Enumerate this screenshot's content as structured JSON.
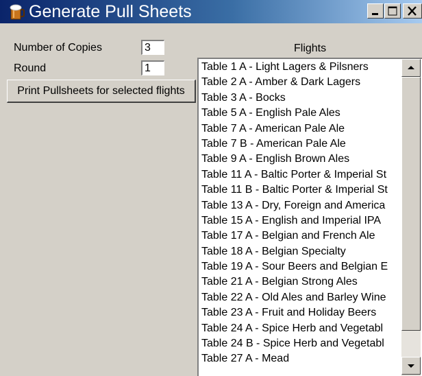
{
  "window": {
    "title": "Generate Pull Sheets",
    "minimize_label": "_",
    "icon": "beer-mug-icon"
  },
  "form": {
    "copies_label": "Number of Copies",
    "copies_value": "3",
    "round_label": "Round",
    "round_value": "1",
    "print_button_label": "Print Pullsheets for selected flights"
  },
  "flights": {
    "header": "Flights",
    "items": [
      "Table 1 A - Light Lagers & Pilsners",
      "Table 2 A - Amber & Dark Lagers",
      "Table 3 A - Bocks",
      "Table 5 A - English Pale Ales",
      "Table 7 A - American Pale Ale",
      "Table 7 B - American Pale Ale",
      "Table 9 A - English Brown Ales",
      "Table 11 A - Baltic Porter & Imperial St",
      "Table 11 B - Baltic Porter & Imperial St",
      "Table 13 A - Dry, Foreign and America",
      "Table 15 A - English and Imperial IPA",
      "Table 17 A - Belgian and French Ale",
      "Table 18 A - Belgian Specialty",
      "Table 19 A - Sour Beers and Belgian E",
      "Table 21 A - Belgian Strong Ales",
      "Table 22 A - Old Ales and Barley Wine",
      "Table 23 A - Fruit and Holiday Beers",
      "Table 24 A - Spice Herb and Vegetabl",
      "Table 24 B - Spice Herb and Vegetabl",
      "Table 27 A - Mead"
    ]
  },
  "colors": {
    "titlebar_start": "#0a246a",
    "titlebar_end": "#a6caf0",
    "window_bg": "#d4d0c8"
  }
}
